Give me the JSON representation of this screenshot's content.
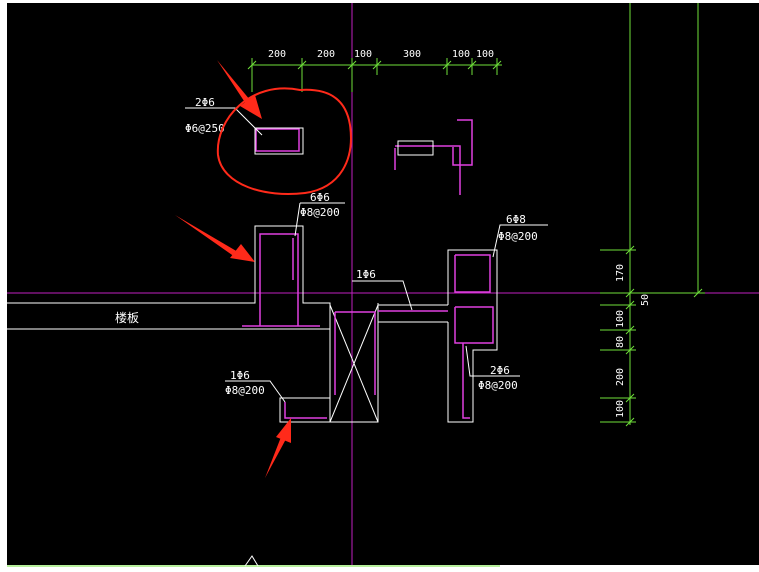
{
  "colors": {
    "background": "#000000",
    "outline": "#ffffff",
    "rebar": "#e040e0",
    "dimension": "#6fe03a",
    "axis": "#c020c0",
    "annotation": "#ff2a1a"
  },
  "dimensions_top": [
    "200",
    "200",
    "100",
    "300",
    "100",
    "100"
  ],
  "dimensions_right": [
    "170",
    "50",
    "100",
    "80",
    "200",
    "100"
  ],
  "labels": {
    "top_left_detail": {
      "count": "2Φ6",
      "stirrup": "Φ6@250"
    },
    "upper_beam": {
      "count": "6Φ6",
      "stirrup": "Φ8@200"
    },
    "right_column": {
      "count": "6Φ8",
      "stirrup": "Φ8@200"
    },
    "middle_bar": {
      "count": "1Φ6"
    },
    "right_lower": {
      "count": "2Φ6",
      "stirrup": "Φ8@200"
    },
    "left_lower": {
      "count": "1Φ6",
      "stirrup": "Φ8@200"
    },
    "slab": "楼板"
  },
  "annotations": {
    "arrows": [
      "arrow-top-detail",
      "arrow-upper-beam",
      "arrow-lower-beam"
    ],
    "circle": "highlight-circle"
  }
}
